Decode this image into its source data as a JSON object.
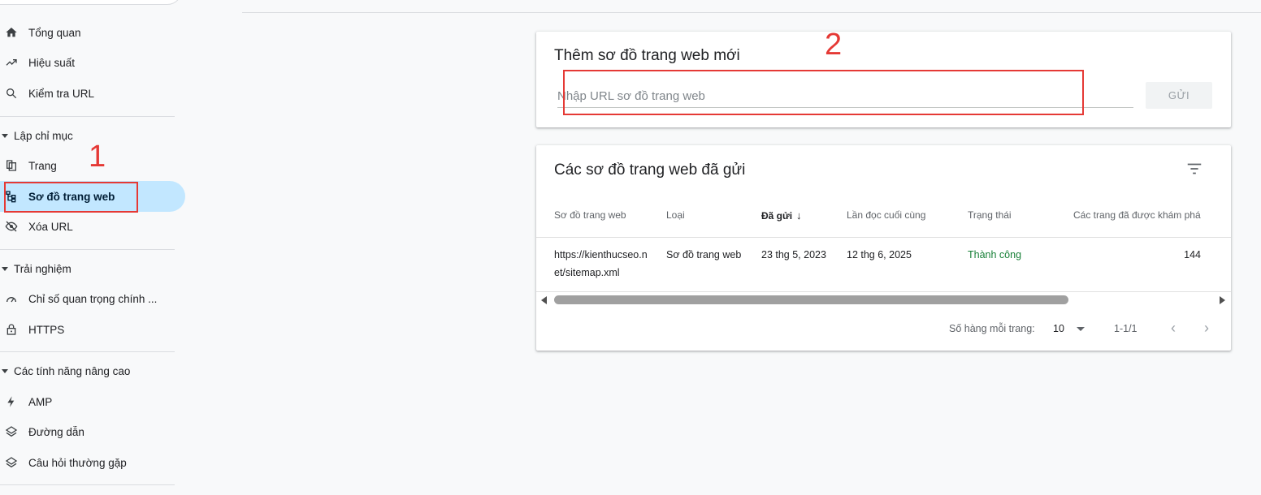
{
  "sidebar": {
    "items": [
      {
        "label": "Tổng quan",
        "icon": "home-icon"
      },
      {
        "label": "Hiệu suất",
        "icon": "trending-up-icon"
      },
      {
        "label": "Kiểm tra URL",
        "icon": "search-icon"
      }
    ],
    "sections": [
      {
        "title": "Lập chỉ mục",
        "items": [
          {
            "label": "Trang",
            "icon": "pages-icon"
          },
          {
            "label": "Sơ đồ trang web",
            "icon": "sitemap-icon",
            "active": true
          },
          {
            "label": "Xóa URL",
            "icon": "visibility-off-icon"
          }
        ]
      },
      {
        "title": "Trải nghiệm",
        "items": [
          {
            "label": "Chỉ số quan trọng chính ...",
            "icon": "speed-icon"
          },
          {
            "label": "HTTPS",
            "icon": "lock-icon"
          }
        ]
      },
      {
        "title": "Các tính năng nâng cao",
        "items": [
          {
            "label": "AMP",
            "icon": "bolt-icon"
          },
          {
            "label": "Đường dẫn",
            "icon": "layers-icon"
          },
          {
            "label": "Câu hỏi thường gặp",
            "icon": "layers-icon"
          }
        ]
      }
    ]
  },
  "add_sitemap": {
    "title": "Thêm sơ đồ trang web mới",
    "placeholder": "Nhập URL sơ đồ trang web",
    "value": "",
    "submit_label": "GỬI"
  },
  "submitted": {
    "title": "Các sơ đồ trang web đã gửi",
    "filter_icon": "filter-icon",
    "columns": [
      "Sơ đồ trang web",
      "Loại",
      "Đã gửi",
      "Lần đọc cuối cùng",
      "Trạng thái",
      "Các trang đã được khám phá"
    ],
    "sorted_column": "Đã gửi",
    "sort_icon": "arrow-down-icon",
    "rows": [
      {
        "sitemap": "https://kienthucseo.net/sitemap.xml",
        "type": "Sơ đồ trang web",
        "submitted": "23 thg 5, 2023",
        "last_read": "12 thg 6, 2025",
        "status": "Thành công",
        "discovered": "144"
      }
    ],
    "pager": {
      "rows_label": "Số hàng mỗi trang:",
      "rows_value": "10",
      "range": "1-1/1",
      "prev": "‹",
      "next": "›"
    }
  },
  "annotations": {
    "label_1": "1",
    "label_2": "2",
    "color": "#e53935"
  },
  "colors": {
    "active_bg": "#c2e7ff",
    "success": "#188038"
  }
}
